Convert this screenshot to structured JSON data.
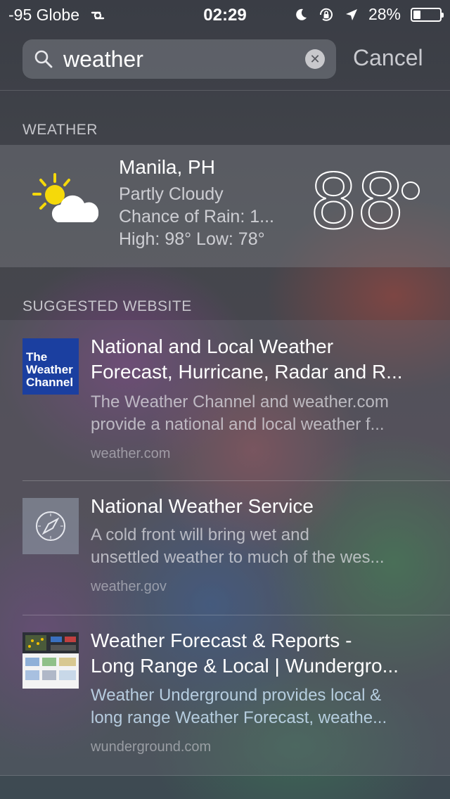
{
  "status": {
    "carrier": "-95 Globe",
    "time": "02:29",
    "battery": "28%",
    "battery_level": 0.28
  },
  "search": {
    "query": "weather",
    "cancel_label": "Cancel"
  },
  "weather_section": {
    "header": "WEATHER",
    "city": "Manila, PH",
    "condition": "Partly Cloudy",
    "rain": "Chance of Rain: 1...",
    "high_low": "High: 98°  Low: 78°",
    "temperature": "88",
    "icon": "partly-cloudy-icon"
  },
  "suggested_section": {
    "header": "SUGGESTED WEBSITE",
    "items": [
      {
        "title_line1": "National and Local Weather",
        "title_line2": "Forecast, Hurricane, Radar and R...",
        "desc_line1": "The Weather Channel and weather.com",
        "desc_line2": "provide a national and local weather f...",
        "url": "weather.com",
        "logo_text": [
          "The",
          "Weather",
          "Channel"
        ],
        "logo_color": "#1b3fa0"
      },
      {
        "title_line1": "National Weather Service",
        "desc_line1": "A cold front will bring wet and",
        "desc_line2": "unsettled weather to much of the wes...",
        "url": "weather.gov",
        "icon": "compass-icon"
      },
      {
        "title_line1": "Weather Forecast & Reports -",
        "title_line2": "Long Range & Local | Wundergro...",
        "desc_line1": "Weather Underground provides local &",
        "desc_line2": "long range Weather Forecast, weathe...",
        "url": "wunderground.com"
      }
    ]
  }
}
